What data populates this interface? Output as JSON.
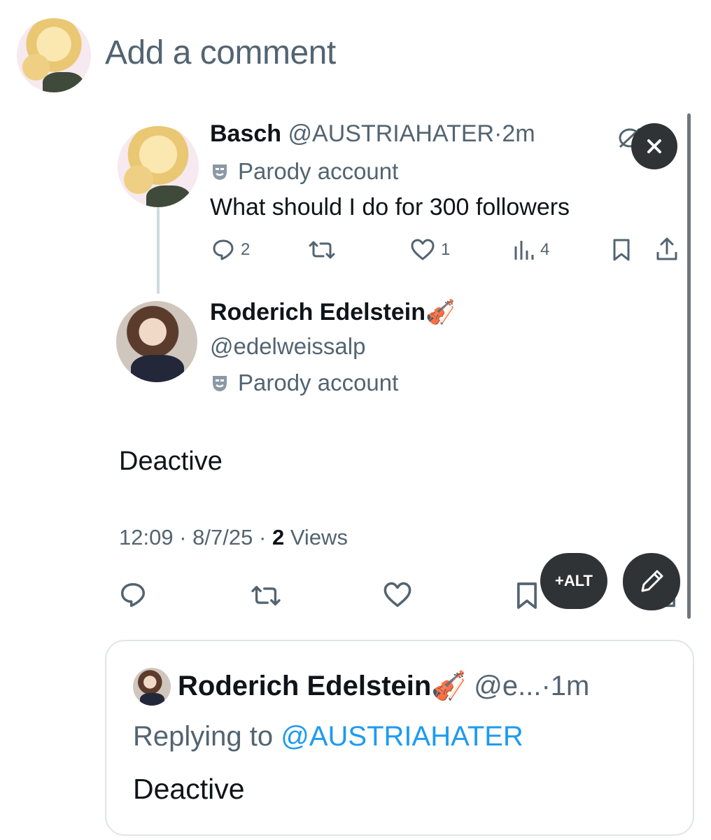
{
  "composer": {
    "placeholder": "Add a comment"
  },
  "parent_post": {
    "display_name": "Basch",
    "handle": "@AUSTRIAHATER",
    "separator": "·",
    "time": "2m",
    "label": "Parody account",
    "text": "What should I do for 300 followers",
    "reply_count": "2",
    "like_count": "1",
    "view_count": "4"
  },
  "main_post": {
    "display_name": "Roderich Edelstein",
    "name_emoji": "🎻",
    "handle": "@edelweissalp",
    "label": "Parody account",
    "text": "Deactive",
    "time": "12:09",
    "date": "8/7/25",
    "views_count": "2",
    "views_label": "Views",
    "separator": "·"
  },
  "media_controls": {
    "alt_label": "+ALT"
  },
  "quote": {
    "display_name": "Roderich Edelstein",
    "name_emoji": "🎻",
    "handle": "@e...",
    "separator": "·",
    "time": "1m",
    "replying_prefix": "Replying to",
    "replying_handle": "@AUSTRIAHATER",
    "text": "Deactive"
  },
  "colors": {
    "text": "#0f1419",
    "secondary": "#536471",
    "accent": "#1d9bf0",
    "dark_button": "#2f3336"
  },
  "icons": [
    "close-icon",
    "reply-icon",
    "retweet-icon",
    "like-icon",
    "views-icon",
    "bookmark-icon",
    "share-icon",
    "pencil-icon",
    "parody-mask-icon",
    "mute-icon",
    "more-icon"
  ]
}
